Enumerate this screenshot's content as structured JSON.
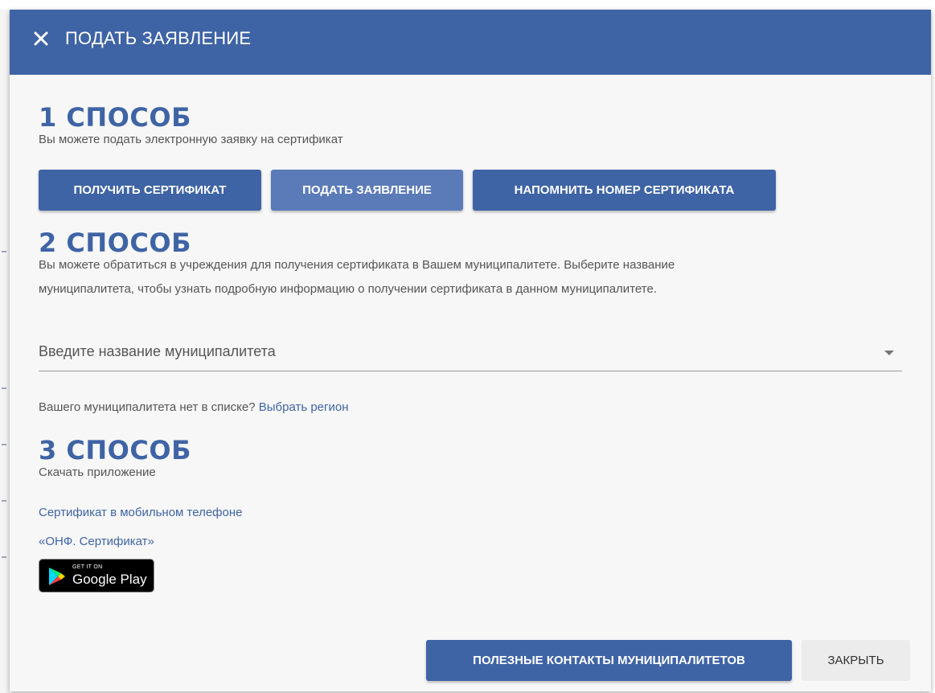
{
  "dialog": {
    "title": "ПОДАТЬ ЗАЯВЛЕНИЕ"
  },
  "method1": {
    "heading": "1 СПОСОБ",
    "description": "Вы можете подать электронную заявку на сертификат",
    "buttons": {
      "get_certificate": "ПОЛУЧИТЬ СЕРТИФИКАТ",
      "submit_application": "ПОДАТЬ ЗАЯВЛЕНИЕ",
      "remind_number": "НАПОМНИТЬ НОМЕР СЕРТИФИКАТА"
    }
  },
  "method2": {
    "heading": "2 СПОСОБ",
    "description_line1": "Вы можете обратиться в учреждения для получения сертификата в Вашем муниципалитете. Выберите название",
    "description_line2": "муниципалитета, чтобы узнать подробную информацию о получении сертификата в данном муниципалитете.",
    "select": {
      "placeholder": "Введите название муниципалитета"
    },
    "note_text": "Вашего муниципалитета нет в списке?",
    "note_link": "Выбрать регион"
  },
  "method3": {
    "heading": "3 СПОСОБ",
    "description": "Скачать приложение",
    "link_mobile": "Сертификат в мобильном телефоне",
    "link_app": "«ОНФ. Сертификат»",
    "google_play": {
      "small": "GET IT ON",
      "store": "Google Play"
    }
  },
  "footer": {
    "contacts_label": "ПОЛЕЗНЫЕ КОНТАКТЫ МУНИЦИПАЛИТЕТОВ",
    "close_label": "ЗАКРЫТЬ"
  },
  "colors": {
    "brand": "#3f64a5",
    "button_light": "#5b7bb8",
    "text_muted": "#555555"
  },
  "icons": [
    "close-icon",
    "chevron-down-icon",
    "google-play-icon"
  ]
}
